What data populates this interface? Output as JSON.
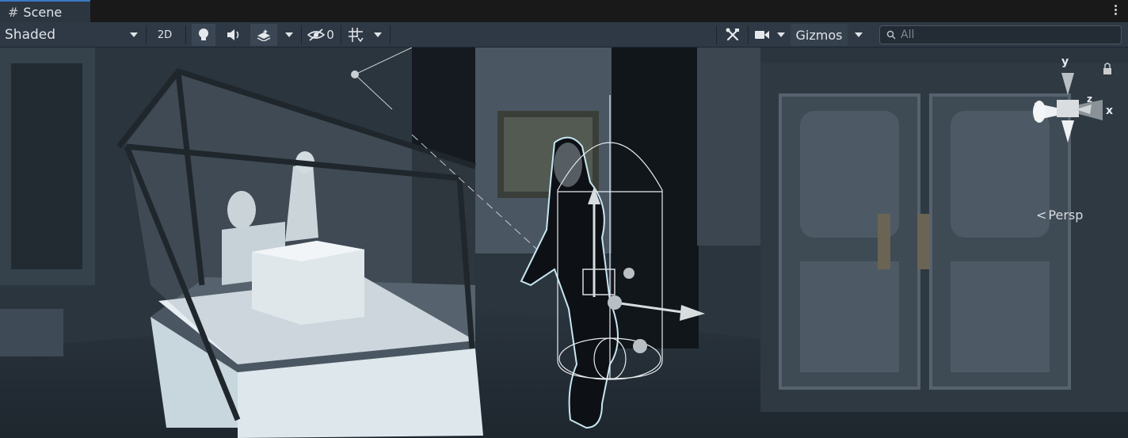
{
  "tab": {
    "title": "Scene",
    "icon": "grid-hash-icon"
  },
  "toolbar": {
    "draw_mode": "Shaded",
    "toggle_2d": "2D",
    "hidden_count": "0",
    "gizmos_label": "Gizmos",
    "search_placeholder": "All"
  },
  "orientation_gizmo": {
    "y_label": "y",
    "z_label": "z",
    "x_label": "x",
    "projection_label": "Persp"
  },
  "icons": [
    "lighting-bulb-icon",
    "audio-speaker-icon",
    "effects-layers-icon",
    "visibility-eye-icon",
    "grid-snap-icon",
    "tools-icon",
    "camera-icon",
    "search-icon",
    "lock-icon"
  ]
}
